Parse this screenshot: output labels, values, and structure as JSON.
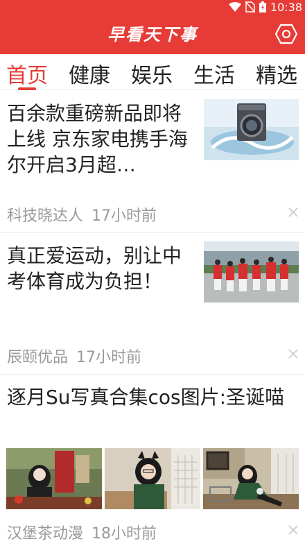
{
  "status": {
    "time": "10:38"
  },
  "app": {
    "title": "早看天下事"
  },
  "tabs": [
    {
      "label": "首页",
      "active": true
    },
    {
      "label": "健康",
      "active": false
    },
    {
      "label": "娱乐",
      "active": false
    },
    {
      "label": "生活",
      "active": false
    },
    {
      "label": "精选",
      "active": false
    }
  ],
  "articles": [
    {
      "title": "百余款重磅新品即将上线 京东家电携手海尔开启3月超…",
      "source": "科技晓达人",
      "time": "17小时前"
    },
    {
      "title": "真正爱运动，别让中考体育成为负担！",
      "source": "辰颐优品",
      "time": "17小时前"
    },
    {
      "title": "逐月Su写真合集cos图片:圣诞喵",
      "source": "汉堡茶动漫",
      "time": "18小时前"
    }
  ],
  "colors": {
    "accent": "#e63b36",
    "meta": "#9a9a9a"
  }
}
